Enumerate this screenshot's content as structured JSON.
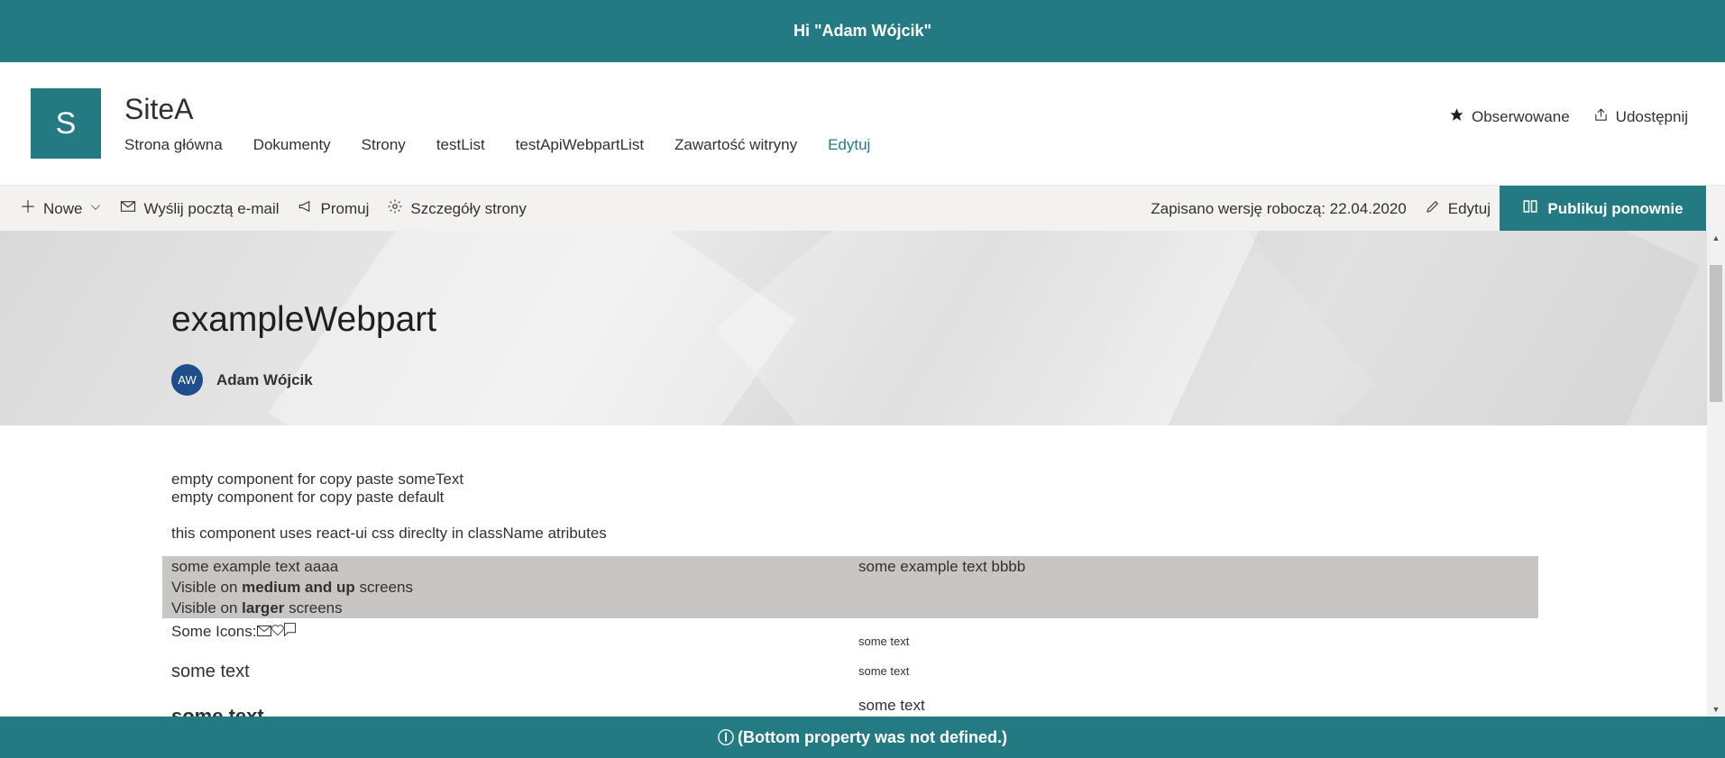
{
  "top_banner": {
    "text": "Hi \"Adam Wójcik\""
  },
  "site": {
    "logo_letter": "S",
    "title": "SiteA",
    "nav": [
      {
        "label": "Strona główna"
      },
      {
        "label": "Dokumenty"
      },
      {
        "label": "Strony"
      },
      {
        "label": "testList"
      },
      {
        "label": "testApiWebpartList"
      },
      {
        "label": "Zawartość witryny"
      },
      {
        "label": "Edytuj"
      }
    ],
    "follow_label": "Obserwowane",
    "share_label": "Udostępnij"
  },
  "command_bar": {
    "new_label": "Nowe",
    "email_label": "Wyślij pocztą e-mail",
    "promote_label": "Promuj",
    "details_label": "Szczegóły strony",
    "saved_text": "Zapisano wersję roboczą: 22.04.2020",
    "edit_label": "Edytuj",
    "publish_label": "Publikuj ponownie"
  },
  "hero": {
    "title": "exampleWebpart",
    "author_initials": "AW",
    "author_name": "Adam Wójcik"
  },
  "content": {
    "line1": "empty component for copy paste someText",
    "line2": "empty component for copy paste default",
    "line3": "this component uses react-ui css direclty in className atributes",
    "box_left_1": "some example text aaaa",
    "box_left_2_pre": "Visible on ",
    "box_left_2_bold": "medium and up",
    "box_left_2_post": " screens",
    "box_left_3_pre": "Visible on ",
    "box_left_3_bold": "larger",
    "box_left_3_post": " screens",
    "box_right_1": "some example text bbbb",
    "icons_label": "Some Icons:",
    "left_text_1": "some text",
    "left_text_2": "some text",
    "right_text_1": "some text",
    "right_text_2": "some text",
    "right_text_3": "some text"
  },
  "bottom_banner": {
    "icon": "ⓘ",
    "text": "(Bottom property was not defined.)"
  },
  "colors": {
    "brand": "#237a82",
    "avatar": "#1f4e8c",
    "grey_box": "#c8c6c4"
  }
}
